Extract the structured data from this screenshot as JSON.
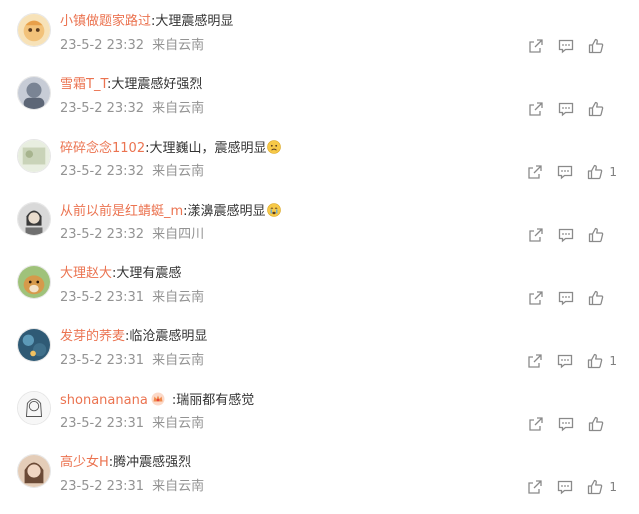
{
  "comments": [
    {
      "username": "小镇做题家路过",
      "text": ":大理震感明显",
      "time": "23-5-2 23:32",
      "location": "来自云南",
      "likes": "",
      "avatar_color": "#f2c27a",
      "emoji": ""
    },
    {
      "username": "雪霜T_T",
      "text": ":大理震感好强烈",
      "time": "23-5-2 23:32",
      "location": "来自云南",
      "likes": "",
      "avatar_color": "#7a8494",
      "emoji": ""
    },
    {
      "username": "碎碎念念1102",
      "text": ":大理巍山，震感明显",
      "time": "23-5-2 23:32",
      "location": "来自云南",
      "likes": "1",
      "avatar_color": "#c9d3b8",
      "emoji": "sad-emoji"
    },
    {
      "username": "从前以前是红蜻蜓_m",
      "text": ":漾濞震感明显",
      "time": "23-5-2 23:32",
      "location": "来自四川",
      "likes": "",
      "avatar_color": "#6f6f6f",
      "emoji": "crying-emoji"
    },
    {
      "username": "大理赵大",
      "text": ":大理有震感",
      "time": "23-5-2 23:31",
      "location": "来自云南",
      "likes": "",
      "avatar_color": "#d69a4b",
      "emoji": ""
    },
    {
      "username": "发芽的荞麦",
      "text": ":临沧震感明显",
      "time": "23-5-2 23:31",
      "location": "来自云南",
      "likes": "1",
      "avatar_color": "#3f6f8a",
      "emoji": ""
    },
    {
      "username": "shonananana",
      "text": " :瑞丽都有感觉",
      "time": "23-5-2 23:31",
      "location": "来自云南",
      "likes": "",
      "avatar_color": "#f0f0f0",
      "emoji": "",
      "badge": "crown-badge-icon"
    },
    {
      "username": "高少女H",
      "text": ":腾冲震感强烈",
      "time": "23-5-2 23:31",
      "location": "来自云南",
      "likes": "1",
      "avatar_color": "#b58a6a",
      "emoji": ""
    }
  ],
  "icons": {
    "forward": "forward-icon",
    "comment": "comment-icon",
    "like": "like-icon"
  },
  "colors": {
    "username": "#eb7350",
    "meta": "#939393",
    "icon": "#8a8a8a"
  }
}
